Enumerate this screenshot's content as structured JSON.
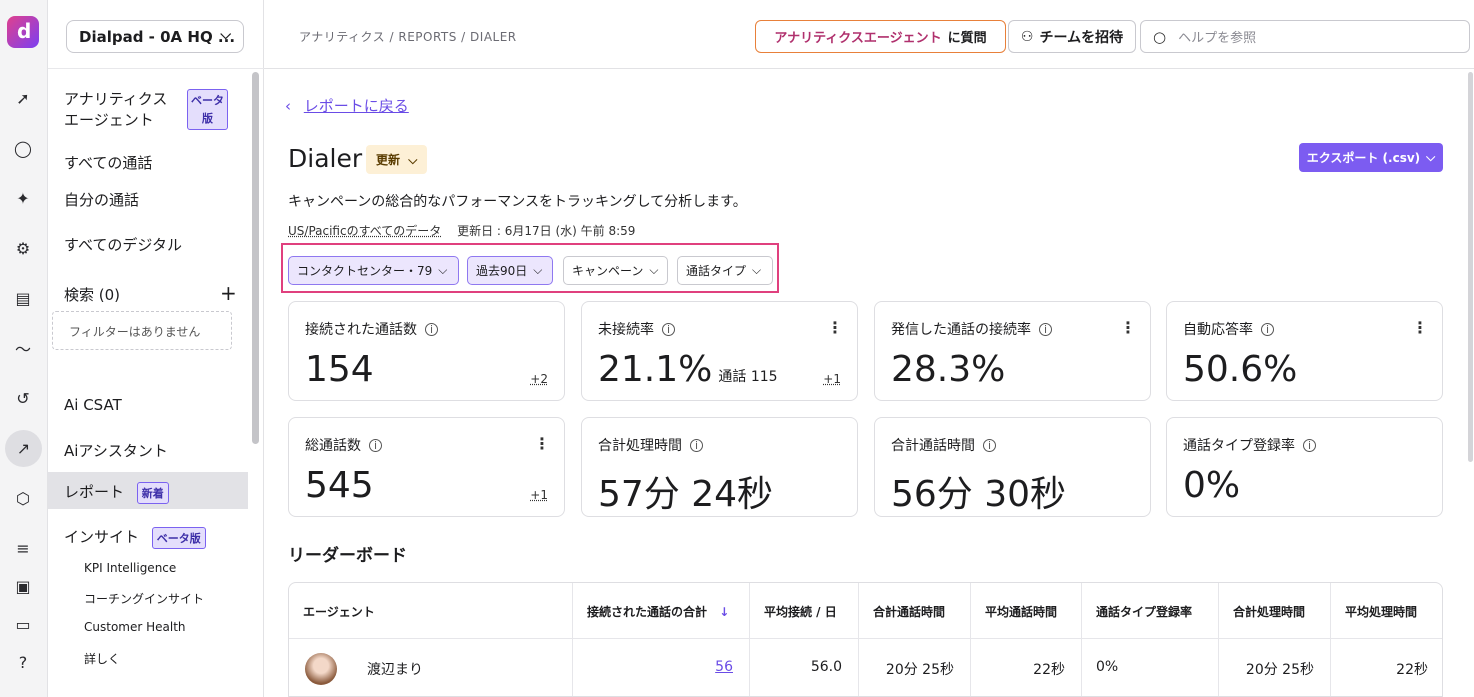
{
  "topbar": {
    "org_name": "Dialpad - 0A HQ ...",
    "breadcrumb": "アナリティクス / REPORTS / DIALER",
    "ask_agent_highlight": "アナリティクスエージェント",
    "ask_agent_suffix": "に質問",
    "invite_label": "チームを招待",
    "search_placeholder": "ヘルプを参照"
  },
  "sidebar": {
    "agent_label": "アナリティクスエージェント",
    "agent_badge": "ベータ版",
    "all_calls": "すべての通話",
    "my_calls": "自分の通話",
    "all_digital": "すべてのデジタル",
    "search_label": "検索 (0)",
    "no_filters": "フィルターはありません",
    "ai_csat": "Ai CSAT",
    "ai_assistant": "Aiアシスタント",
    "reports": "レポート",
    "reports_badge": "新着",
    "insights": "インサイト",
    "insights_badge": "ベータ版",
    "sub_items": [
      "KPI Intelligence",
      "コーチングインサイト",
      "Customer Health",
      "詳しく"
    ]
  },
  "page": {
    "back_label": "レポートに戻る",
    "title": "Dialer",
    "update_label": "更新",
    "export_label": "エクスポート (.csv)",
    "description": "キャンペーンの総合的なパフォーマンスをトラッキングして分析します。",
    "timezone_label": "US/Pacificのすべてのデータ",
    "updated_at": "更新日 : 6月17日 (水) 午前 8:59"
  },
  "filters": {
    "contact_center": "コンタクトセンター・79",
    "period": "過去90日",
    "campaign": "キャンペーン",
    "call_type": "通話タイプ"
  },
  "cards": [
    {
      "label": "接続された通話数",
      "value": "154",
      "sub": "",
      "delta": "+2"
    },
    {
      "label": "未接続率",
      "value": "21.1%",
      "sub": "通話 115",
      "delta": "+1"
    },
    {
      "label": "発信した通話の接続率",
      "value": "28.3%",
      "sub": "",
      "delta": ""
    },
    {
      "label": "自動応答率",
      "value": "50.6%",
      "sub": "",
      "delta": ""
    },
    {
      "label": "総通話数",
      "value": "545",
      "sub": "",
      "delta": "+1"
    },
    {
      "label": "合計処理時間",
      "value": "57分 24秒",
      "sub": "",
      "delta": ""
    },
    {
      "label": "合計通話時間",
      "value": "56分 30秒",
      "sub": "",
      "delta": ""
    },
    {
      "label": "通話タイプ登録率",
      "value": "0%",
      "sub": "",
      "delta": ""
    }
  ],
  "leaderboard": {
    "title": "リーダーボード",
    "columns": [
      "エージェント",
      "接続された通話の合計",
      "平均接続 / 日",
      "合計通話時間",
      "平均通話時間",
      "通話タイプ登録率",
      "合計処理時間",
      "平均処理時間"
    ],
    "rows": [
      {
        "agent": "渡辺まり",
        "connected": "56",
        "avg_per_day": "56.0",
        "total_talk": "20分 25秒",
        "avg_talk": "22秒",
        "call_type_rate": "0%",
        "total_handle": "20分 25秒",
        "avg_handle": "22秒"
      }
    ]
  }
}
